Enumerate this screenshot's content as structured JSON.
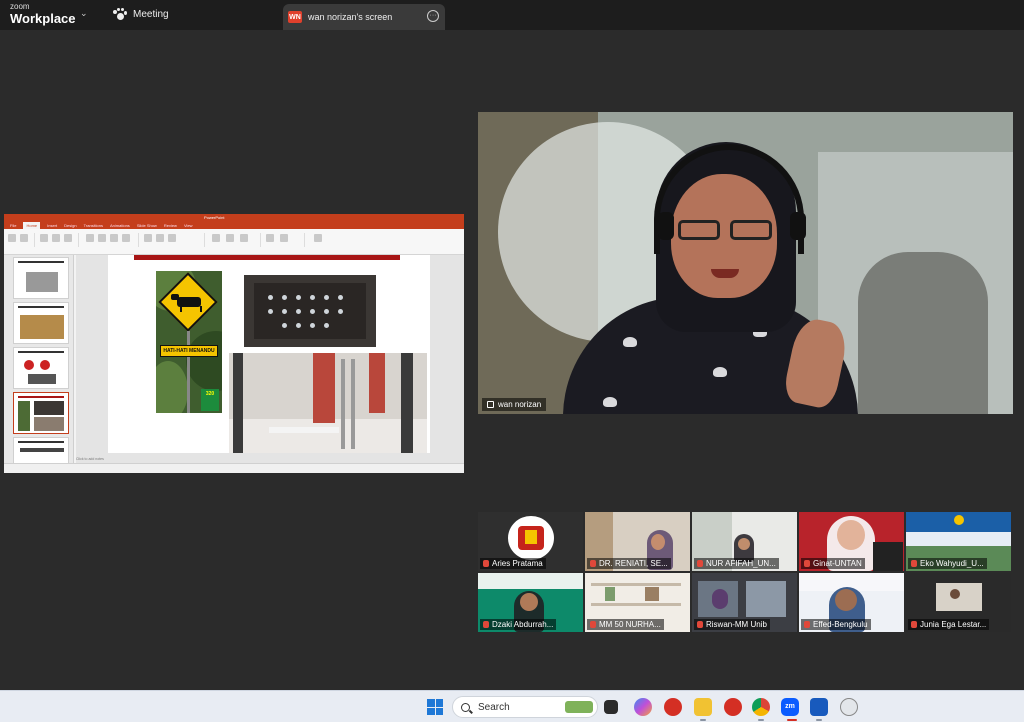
{
  "app": {
    "brand_small": "zoom",
    "brand_big": "Workplace",
    "meeting_label": "Meeting",
    "share_badge": "WN",
    "share_tab_label": "wan norizan's screen",
    "more_label": "···"
  },
  "shared_screen": {
    "title_bar": "PowerPoint",
    "ribbon_tabs": [
      "File",
      "Home",
      "Insert",
      "Design",
      "Transitions",
      "Animations",
      "Slide Show",
      "Review",
      "View"
    ],
    "active_tab": "Home",
    "sign_text": "HATI-HATI MENANDU",
    "km_text": "320",
    "notes_placeholder": "Click to add notes"
  },
  "speaker": {
    "name": "wan norizan"
  },
  "gallery": {
    "participants": [
      "Aries Pratama",
      "DR. RENIATI, SE...",
      "NUR AFIFAH_UN...",
      "Ginat-UNTAN",
      "Eko Wahyudi_U...",
      "Dzaki Abdurrah...",
      "MM 50 NURHA...",
      "Riswan-MM Unib",
      "Effed-Bengkulu",
      "Junia Ega Lestar..."
    ]
  },
  "taskbar": {
    "search_placeholder": "Search",
    "icons": [
      "windows-start-icon",
      "task-view-icon",
      "copilot-icon",
      "red-app-icon",
      "file-explorer-icon",
      "red-app-icon",
      "chrome-icon",
      "zoom-icon",
      "word-icon",
      "network-icon"
    ]
  },
  "colors": {
    "topbar": "#1d1d1d",
    "canvas": "#2b2b2b",
    "powerpoint_accent": "#c43e1c",
    "muted_mic": "#e0483a",
    "taskbar": "#e8ecf3"
  }
}
